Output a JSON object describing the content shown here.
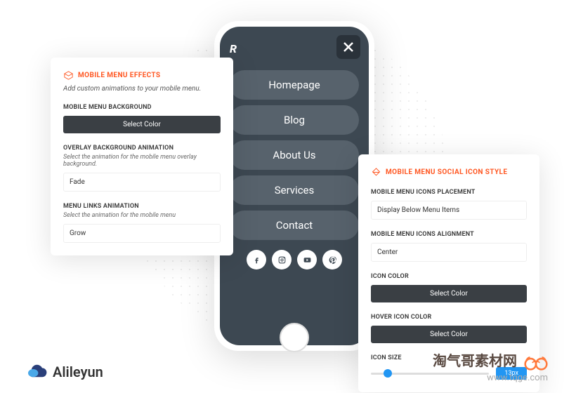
{
  "effects": {
    "title": "MOBILE MENU EFFECTS",
    "subtitle": "Add custom animations to your mobile menu.",
    "bg_label": "MOBILE MENU BACKGROUND",
    "bg_btn": "Select Color",
    "overlay_label": "OVERLAY BACKGROUND ANIMATION",
    "overlay_desc": "Select the animation for the mobile menu overlay background.",
    "overlay_val": "Fade",
    "links_label": "MENU LINKS ANIMATION",
    "links_desc": "Select the animation for the mobile menu",
    "links_val": "Grow"
  },
  "social": {
    "title": "MOBILE MENU SOCIAL ICON STYLE",
    "placement_label": "MOBILE MENU ICONS PLACEMENT",
    "placement_val": "Display Below Menu Items",
    "align_label": "MOBILE MENU ICONS ALIGNMENT",
    "align_val": "Center",
    "icon_color_label": "ICON COLOR",
    "icon_color_btn": "Select Color",
    "hover_color_label": "HOVER ICON COLOR",
    "hover_color_btn": "Select Color",
    "size_label": "ICON SIZE",
    "size_val": "13px"
  },
  "phone": {
    "brand": "R",
    "menu": [
      "Homepage",
      "Blog",
      "About Us",
      "Services",
      "Contact"
    ]
  },
  "footer": {
    "left_name": "Alileyun",
    "right_cn": "淘气哥素材网",
    "right_url": "www.tqge.com"
  }
}
